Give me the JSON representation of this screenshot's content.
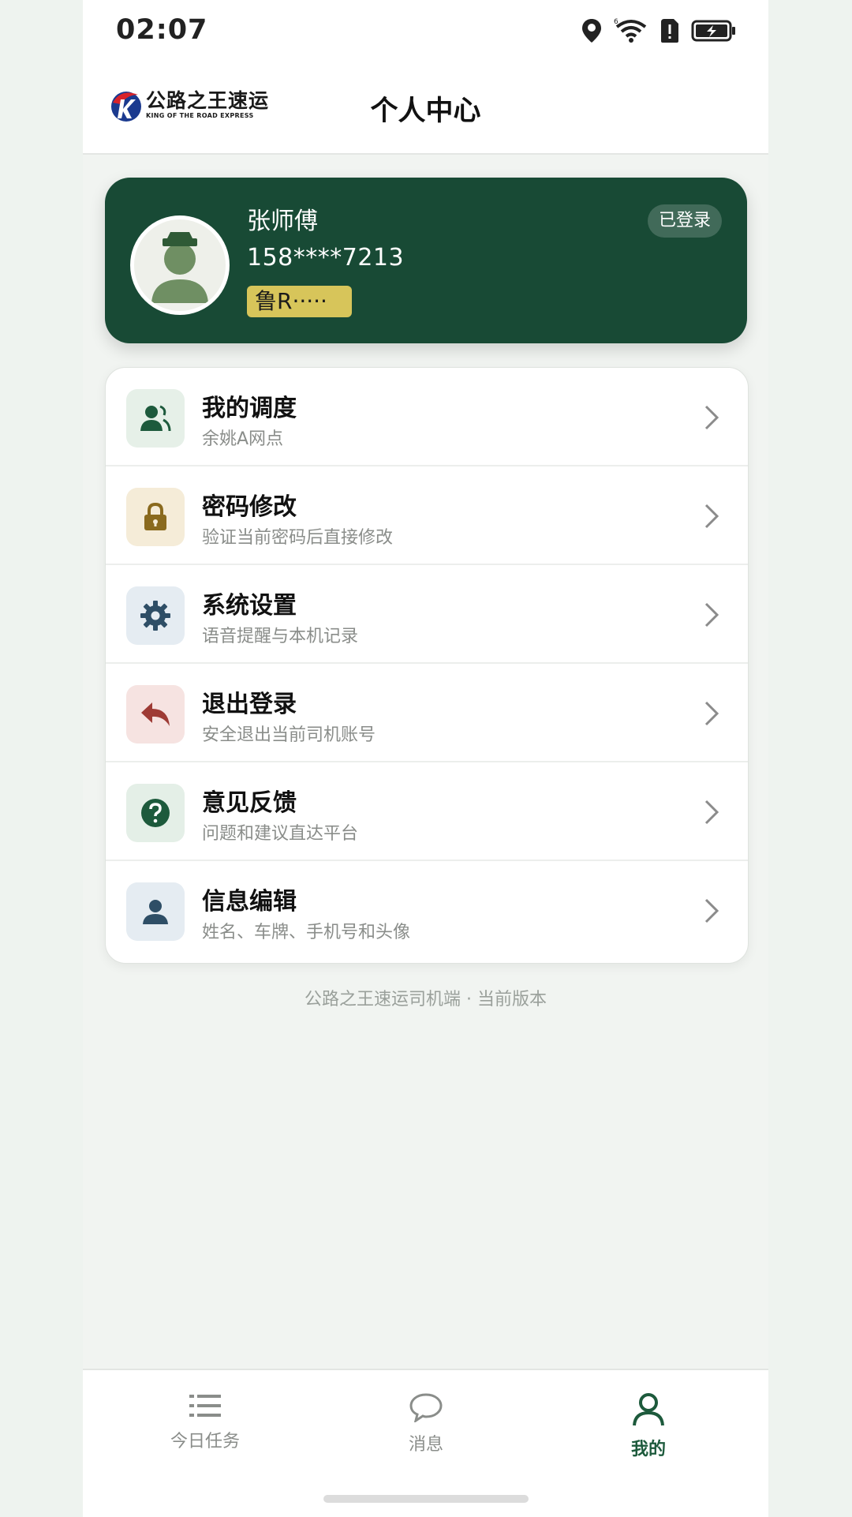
{
  "status_bar": {
    "time": "02:07"
  },
  "header": {
    "logo_cn": "公路之王速运",
    "logo_en": "KING OF THE ROAD EXPRESS",
    "title": "个人中心"
  },
  "profile": {
    "name": "张师傅",
    "phone": "158****7213",
    "plate": "鲁R·····",
    "login_status": "已登录"
  },
  "menu": [
    {
      "title": "我的调度",
      "subtitle": "余姚A网点",
      "icon": "dispatch-users-icon",
      "bg": "#e6f0e8",
      "color": "#1d5a3c"
    },
    {
      "title": "密码修改",
      "subtitle": "验证当前密码后直接修改",
      "icon": "lock-icon",
      "bg": "#f5ecd8",
      "color": "#8a6a1e"
    },
    {
      "title": "系统设置",
      "subtitle": "语音提醒与本机记录",
      "icon": "gear-icon",
      "bg": "#e5ecf2",
      "color": "#2e4e66"
    },
    {
      "title": "退出登录",
      "subtitle": "安全退出当前司机账号",
      "icon": "reply-arrow-icon",
      "bg": "#f6e3e1",
      "color": "#9e3b35"
    },
    {
      "title": "意见反馈",
      "subtitle": "问题和建议直达平台",
      "icon": "question-icon",
      "bg": "#e4efe7",
      "color": "#1d5a3c"
    },
    {
      "title": "信息编辑",
      "subtitle": "姓名、车牌、手机号和头像",
      "icon": "user-icon",
      "bg": "#e5ecf2",
      "color": "#2e4e66"
    }
  ],
  "footer_note": "公路之王速运司机端 · 当前版本",
  "bottom_nav": [
    {
      "label": "今日任务",
      "icon": "list-icon",
      "active": false
    },
    {
      "label": "消息",
      "icon": "chat-bubble-icon",
      "active": false
    },
    {
      "label": "我的",
      "icon": "person-icon",
      "active": true
    }
  ],
  "colors": {
    "brand_green": "#184a35",
    "plate_yellow": "#d7c55a",
    "inactive_gray": "#8a8d8a"
  }
}
